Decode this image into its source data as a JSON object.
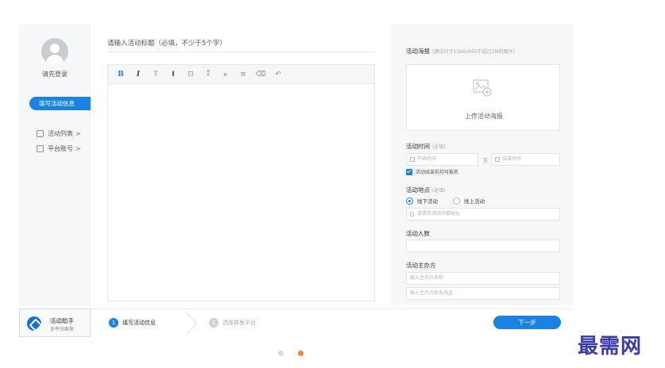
{
  "sidebar": {
    "login_text": "请先登录",
    "active_item": "填写活动信息",
    "items": [
      {
        "label": "活动列表",
        "chevron": ">"
      },
      {
        "label": "平台账号",
        "chevron": ">"
      }
    ]
  },
  "brand": {
    "name": "活动助手",
    "subtitle": "多平台群发"
  },
  "editor": {
    "title_placeholder": "请输入活动标题（必填，不少于5个字）",
    "toolbar": {
      "bold": "B",
      "italic": "I",
      "text": "T",
      "clear": "I",
      "image": "⊡",
      "quote": "⁑",
      "indent": "⫸",
      "align": "≡",
      "delete": "⌫",
      "undo": "↶"
    }
  },
  "panel": {
    "poster_label": "活动海报",
    "poster_hint": "(建议尺寸1366x650不超过2M的图片)",
    "poster_upload": "上传活动海报",
    "time_label": "活动时间",
    "time_hint": "(必填)",
    "start_placeholder": "开始时间",
    "range_to": "至",
    "end_placeholder": "结束时间",
    "allow_signup": "活动结束前均可报名",
    "location_label": "活动地点",
    "location_hint": "(必填)",
    "offline": "线下活动",
    "online": "线上活动",
    "address_placeholder": "请填写活动详细地址",
    "count_label": "活动人数",
    "host_label": "活动主办方",
    "host_name_placeholder": "输入主办方名称",
    "host_phone_placeholder": "输入主办方联系电话"
  },
  "steps": [
    {
      "num": "1",
      "label": "填写活动信息"
    },
    {
      "num": "2",
      "label": "选择群发平台"
    }
  ],
  "next_button": "下一步",
  "watermark": "最需网",
  "colors": {
    "accent": "#1a82e0",
    "active_dot": "#f08a2e",
    "inactive_dot": "#d8dadd",
    "watermark": "#3b3aa8"
  }
}
